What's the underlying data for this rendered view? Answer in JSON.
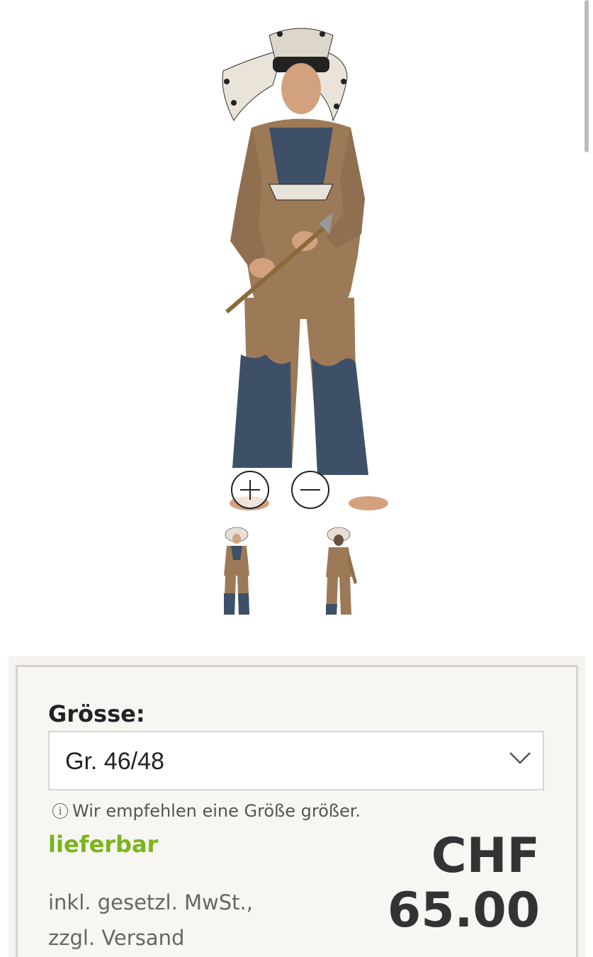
{
  "product": {
    "images": [
      {
        "name": "front-view"
      },
      {
        "name": "back-view"
      }
    ]
  },
  "zoom": {
    "in_icon": "zoom-in-icon",
    "out_icon": "zoom-out-icon"
  },
  "purchase": {
    "size_label": "Grösse:",
    "size_selected": "Gr. 46/48",
    "size_hint": "Wir empfehlen eine Größe größer.",
    "availability": "lieferbar",
    "tax_line1": "inkl. gesetzl. MwSt.,",
    "tax_line2": "zzgl. Versand",
    "price_currency": "CHF",
    "price_value": "65.00"
  },
  "colors": {
    "availability": "#7ab51d",
    "costume_brown": "#9c7a58",
    "costume_blue": "#3d5068"
  }
}
